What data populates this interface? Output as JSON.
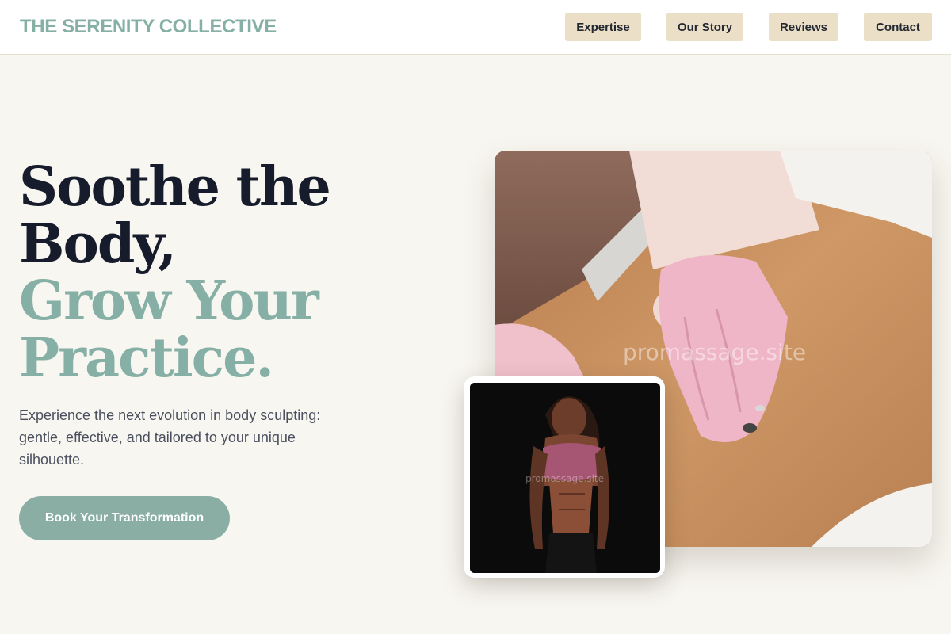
{
  "header": {
    "brand": "THE SERENITY COLLECTIVE",
    "nav": [
      {
        "label": "Expertise"
      },
      {
        "label": "Our Story"
      },
      {
        "label": "Reviews"
      },
      {
        "label": "Contact"
      }
    ]
  },
  "hero": {
    "title_dark_line1": "Soothe the",
    "title_dark_line2": "Body,",
    "title_accent_line1": "Grow Your",
    "title_accent_line2": "Practice.",
    "subtitle": "Experience the next evolution in body sculpting: gentle, effective, and tailored to your unique silhouette.",
    "cta_label": "Book Your Transformation"
  },
  "media": {
    "main_image_watermark": "promassage.site",
    "inset_image_watermark": "promassage.site"
  },
  "colors": {
    "background": "#f8f6f0",
    "accent": "#86b0a5",
    "nav_button": "#ecdfc8",
    "heading_dark": "#161c2c",
    "cta": "#8aaea4"
  }
}
